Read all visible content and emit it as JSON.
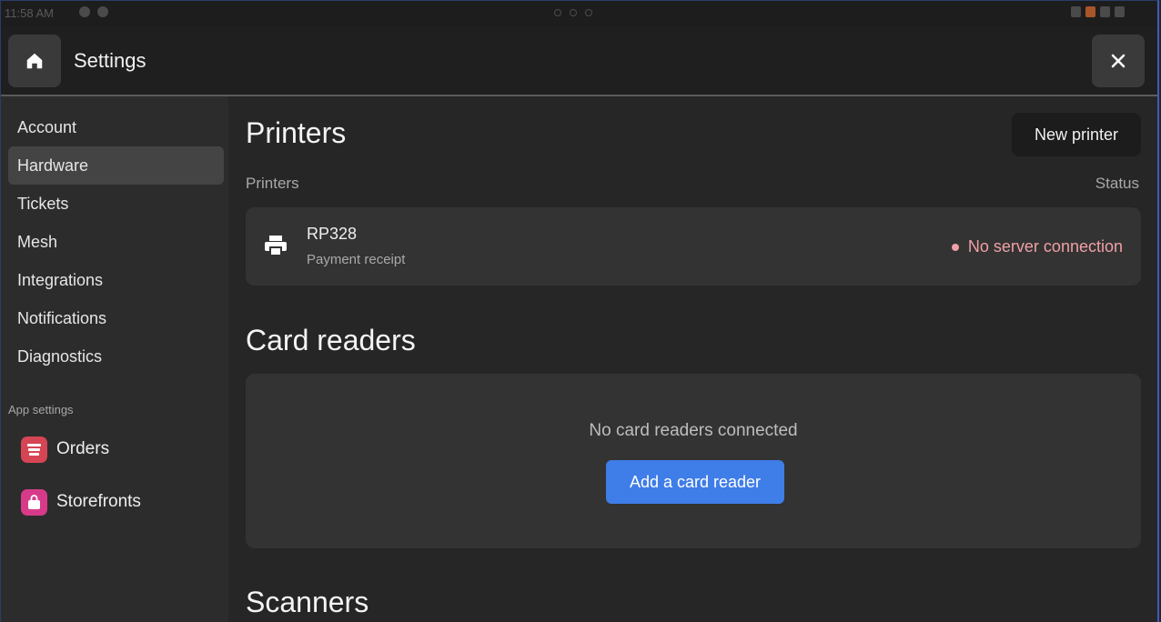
{
  "status_bar": {
    "time": "11:58 AM"
  },
  "header": {
    "title": "Settings"
  },
  "sidebar": {
    "items": [
      {
        "label": "Account",
        "active": false
      },
      {
        "label": "Hardware",
        "active": true
      },
      {
        "label": "Tickets",
        "active": false
      },
      {
        "label": "Mesh",
        "active": false
      },
      {
        "label": "Integrations",
        "active": false
      },
      {
        "label": "Notifications",
        "active": false
      },
      {
        "label": "Diagnostics",
        "active": false
      }
    ],
    "section_label": "App settings",
    "apps": [
      {
        "label": "Orders",
        "icon": "orders-icon",
        "color": "#d64553"
      },
      {
        "label": "Storefronts",
        "icon": "storefronts-icon",
        "color": "#d83a8a"
      }
    ]
  },
  "main": {
    "printers": {
      "title": "Printers",
      "new_button": "New printer",
      "column_left": "Printers",
      "column_right": "Status",
      "items": [
        {
          "name": "RP328",
          "type": "Payment receipt",
          "status": "No server connection",
          "status_color": "#f0a0a6"
        }
      ]
    },
    "card_readers": {
      "title": "Card readers",
      "empty_text": "No card readers connected",
      "add_button": "Add a card reader",
      "accent": "#3f7de8"
    },
    "scanners": {
      "title": "Scanners"
    }
  }
}
